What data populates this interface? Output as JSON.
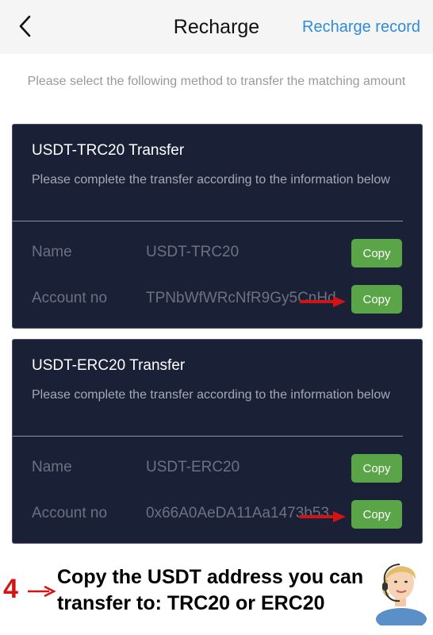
{
  "header": {
    "title": "Recharge",
    "record_label": "Recharge record"
  },
  "intro": "Please select the following method to transfer the matching amount",
  "cards": [
    {
      "title": "USDT-TRC20 Transfer",
      "desc": "Please complete the transfer according to the information below",
      "name_label": "Name",
      "name_value": "USDT-TRC20",
      "account_label": "Account no",
      "account_value": "TPNbWfWRcNfR9Gy5CnHd",
      "copy_label": "Copy"
    },
    {
      "title": "USDT-ERC20 Transfer",
      "desc": "Please complete the transfer according to the information below",
      "name_label": "Name",
      "name_value": "USDT-ERC20",
      "account_label": "Account no",
      "account_value": "0x66A0AeDA11Aa1473b53",
      "copy_label": "Copy"
    }
  ],
  "note": {
    "number": "4",
    "text": "Copy the USDT address you can transfer to: TRC20 or ERC20"
  },
  "colors": {
    "card_bg": "#1a2137",
    "copy_button": "#5aa548",
    "link": "#2d8cdb",
    "annotation": "#d21414"
  },
  "icons": {
    "back": "chevron-left-icon",
    "arrow": "red-arrow-icon",
    "avatar": "support-agent-icon"
  }
}
